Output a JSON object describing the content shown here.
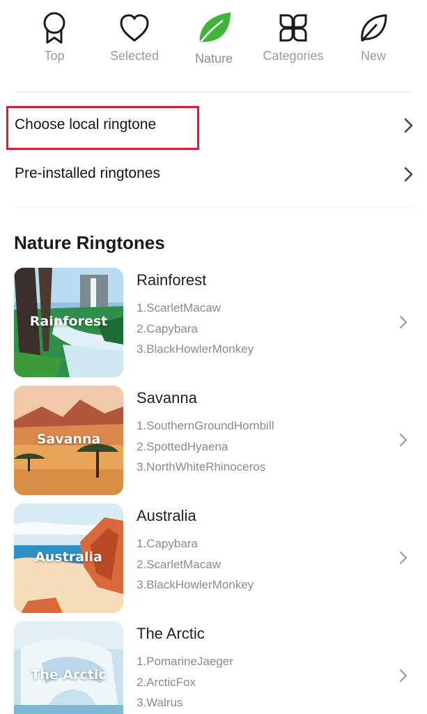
{
  "nav": {
    "items": [
      {
        "label": "Top",
        "icon": "ribbon-badge-icon"
      },
      {
        "label": "Selected",
        "icon": "heart-icon"
      },
      {
        "label": "Nature",
        "icon": "leaf-icon",
        "active": true
      },
      {
        "label": "Categories",
        "icon": "four-petal-grid-icon"
      },
      {
        "label": "New",
        "icon": "leaf-outline-icon"
      }
    ]
  },
  "menu": {
    "choose_local": "Choose local ringtone",
    "pre_installed": "Pre-installed ringtones"
  },
  "section": {
    "title": "Nature Ringtones"
  },
  "cards": [
    {
      "thumb_label": "Rainforest",
      "title": "Rainforest",
      "items": [
        "1.ScarletMacaw",
        "2.Capybara",
        "3.BlackHowlerMonkey"
      ]
    },
    {
      "thumb_label": "Savanna",
      "title": "Savanna",
      "items": [
        "1.SouthernGroundHornbill",
        "2.SpottedHyaena",
        "3.NorthWhiteRhinoceros"
      ]
    },
    {
      "thumb_label": "Australia",
      "title": "Australia",
      "items": [
        "1.Capybara",
        "2.ScarletMacaw",
        "3.BlackHowlerMonkey"
      ]
    },
    {
      "thumb_label": "The Arctic",
      "title": "The Arctic",
      "items": [
        "1.PomarineJaeger",
        "2.ArcticFox",
        "3.Walrus"
      ]
    }
  ],
  "colors": {
    "highlight_border": "#d81e2a",
    "active_icon": "#3fb33a",
    "label_gray": "#9a9a9a"
  }
}
